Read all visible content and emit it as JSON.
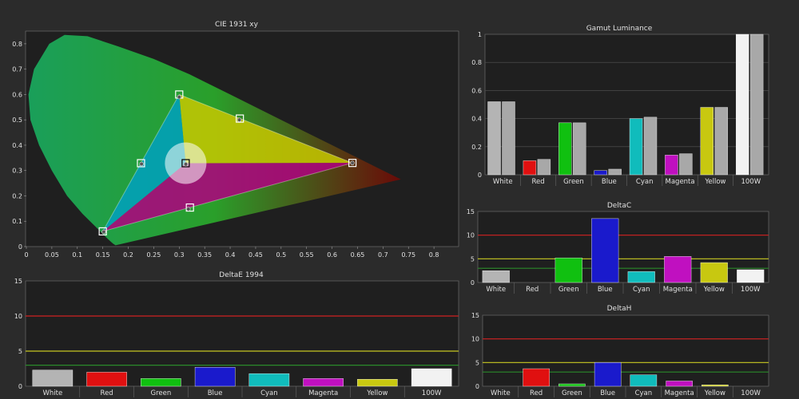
{
  "chart_data": [
    {
      "id": "cie",
      "type": "scatter",
      "title": "CIE 1931 xy",
      "xlim": [
        0,
        0.85
      ],
      "ylim": [
        0,
        0.85
      ],
      "xticks": [
        "0",
        "0.05",
        "0.1",
        "0.15",
        "0.2",
        "0.25",
        "0.3",
        "0.35",
        "0.4",
        "0.45",
        "0.5",
        "0.55",
        "0.6",
        "0.65",
        "0.7",
        "0.75",
        "0.8"
      ],
      "yticks": [
        "0",
        "0.1",
        "0.2",
        "0.3",
        "0.4",
        "0.5",
        "0.6",
        "0.7",
        "0.8"
      ],
      "targets": [
        {
          "name": "Red",
          "x": 0.64,
          "y": 0.33
        },
        {
          "name": "Green",
          "x": 0.3,
          "y": 0.6
        },
        {
          "name": "Blue",
          "x": 0.15,
          "y": 0.06
        },
        {
          "name": "White",
          "x": 0.3127,
          "y": 0.329
        },
        {
          "name": "Cyan",
          "x": 0.225,
          "y": 0.329
        },
        {
          "name": "Magenta",
          "x": 0.321,
          "y": 0.154
        },
        {
          "name": "Yellow",
          "x": 0.419,
          "y": 0.505
        }
      ],
      "measured": [
        {
          "name": "Red",
          "x": 0.64,
          "y": 0.33
        },
        {
          "name": "Green",
          "x": 0.3,
          "y": 0.59
        },
        {
          "name": "Blue",
          "x": 0.152,
          "y": 0.058
        },
        {
          "name": "White",
          "x": 0.313,
          "y": 0.325
        },
        {
          "name": "Cyan",
          "x": 0.226,
          "y": 0.326
        },
        {
          "name": "Magenta",
          "x": 0.318,
          "y": 0.148
        },
        {
          "name": "Yellow",
          "x": 0.418,
          "y": 0.5
        }
      ]
    },
    {
      "id": "lum",
      "type": "bar",
      "title": "Gamut Luminance",
      "ylim": [
        0,
        1
      ],
      "yticks": [
        "0",
        "0.2",
        "0.4",
        "0.6",
        "0.8",
        "1"
      ],
      "categories": [
        "White",
        "Red",
        "Green",
        "Blue",
        "Cyan",
        "Magenta",
        "Yellow",
        "100W"
      ],
      "colors": [
        "#b4b4b4",
        "#e01010",
        "#10c010",
        "#1a1acc",
        "#10bcbc",
        "#c010c0",
        "#c8c810",
        "#f2f2f2"
      ],
      "measured": [
        0.52,
        0.1,
        0.37,
        0.03,
        0.4,
        0.14,
        0.48,
        1.0
      ],
      "target": [
        0.52,
        0.11,
        0.37,
        0.04,
        0.41,
        0.15,
        0.48,
        1.0
      ]
    },
    {
      "id": "dc",
      "type": "bar",
      "title": "DeltaC",
      "ylim": [
        0,
        15
      ],
      "yticks": [
        "0",
        "5",
        "10",
        "15"
      ],
      "categories": [
        "White",
        "Red",
        "Green",
        "Blue",
        "Cyan",
        "Magenta",
        "Yellow",
        "100W"
      ],
      "colors": [
        "#b4b4b4",
        "#e01010",
        "#10c010",
        "#1a1acc",
        "#10bcbc",
        "#c010c0",
        "#c8c810",
        "#f2f2f2"
      ],
      "values": [
        2.5,
        0,
        5.2,
        13.5,
        2.3,
        5.5,
        4.2,
        2.7
      ],
      "thresholds": [
        3,
        5,
        10
      ]
    },
    {
      "id": "de",
      "type": "bar",
      "title": "DeltaE 1994",
      "ylim": [
        0,
        15
      ],
      "yticks": [
        "0",
        "5",
        "10",
        "15"
      ],
      "categories": [
        "White",
        "Red",
        "Green",
        "Blue",
        "Cyan",
        "Magenta",
        "Yellow",
        "100W"
      ],
      "colors": [
        "#b4b4b4",
        "#e01010",
        "#10c010",
        "#1a1acc",
        "#10bcbc",
        "#c010c0",
        "#c8c810",
        "#f2f2f2"
      ],
      "values": [
        2.3,
        2.0,
        1.1,
        2.7,
        1.8,
        1.1,
        1.0,
        2.5
      ],
      "thresholds": [
        3,
        5,
        10
      ]
    },
    {
      "id": "dh",
      "type": "bar",
      "title": "DeltaH",
      "ylim": [
        0,
        15
      ],
      "yticks": [
        "0",
        "5",
        "10",
        "15"
      ],
      "categories": [
        "White",
        "Red",
        "Green",
        "Blue",
        "Cyan",
        "Magenta",
        "Yellow",
        "100W"
      ],
      "colors": [
        "#b4b4b4",
        "#e01010",
        "#10c010",
        "#1a1acc",
        "#10bcbc",
        "#c010c0",
        "#c8c810",
        "#f2f2f2"
      ],
      "values": [
        0,
        3.7,
        0.5,
        5.0,
        2.4,
        1.1,
        0.3,
        0
      ],
      "thresholds": [
        3,
        5,
        10
      ]
    }
  ],
  "theme": {
    "background": "#2b2b2b",
    "plot_background": "#1f1f1f",
    "grid": "#555555",
    "text": "#e0e0e0",
    "threshold_colors": [
      "#2a8a2a",
      "#c8c820",
      "#d02020"
    ]
  }
}
